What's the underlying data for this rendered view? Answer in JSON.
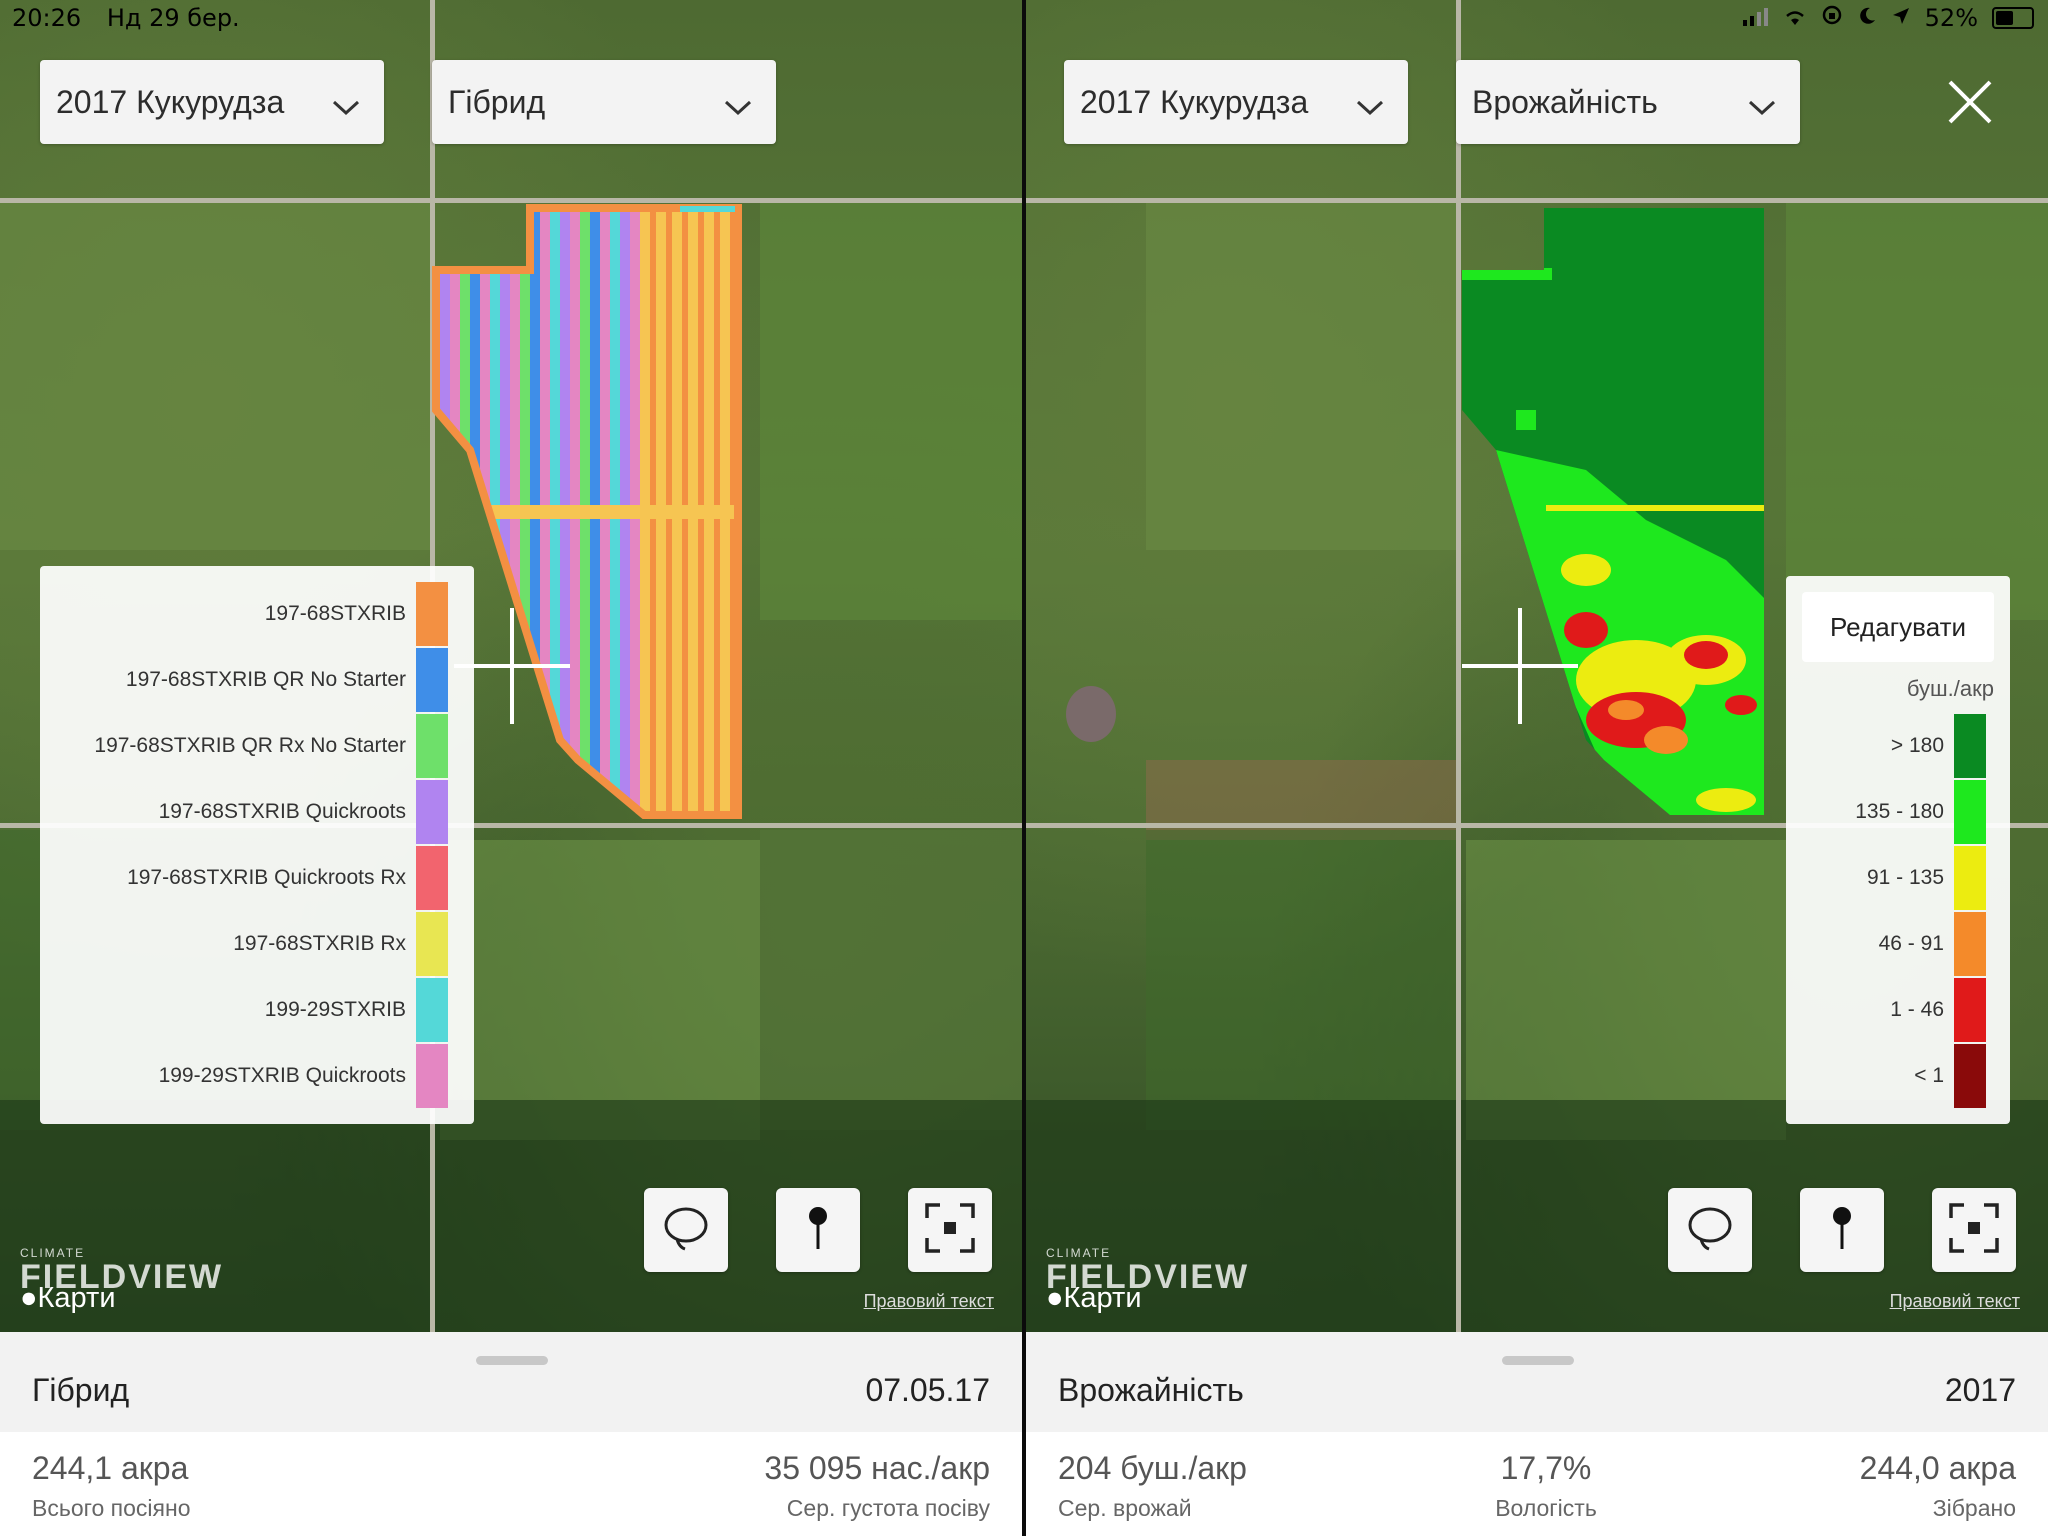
{
  "status_bar": {
    "time": "20:26",
    "date": "Нд 29 бер.",
    "battery": "52%"
  },
  "left": {
    "season_dropdown": "2017 Кукурудза",
    "layer_dropdown": "Гібрид",
    "legend": [
      {
        "label": "197-68STXRIB",
        "color": "#f39042"
      },
      {
        "label": "197-68STXRIB QR No Starter",
        "color": "#3f8ee8"
      },
      {
        "label": "197-68STXRIB QR Rx No Starter",
        "color": "#6ee06a"
      },
      {
        "label": "197-68STXRIB Quickroots",
        "color": "#b084f0"
      },
      {
        "label": "197-68STXRIB Quickroots Rx",
        "color": "#f2646e"
      },
      {
        "label": "197-68STXRIB Rx",
        "color": "#e8e652"
      },
      {
        "label": "199-29STXRIB",
        "color": "#54d8d8"
      },
      {
        "label": "199-29STXRIB Quickroots",
        "color": "#e486c2"
      }
    ],
    "sheet": {
      "title": "Гібрид",
      "date": "07.05.17",
      "stats": [
        {
          "value": "244,1 акра",
          "label": "Всього посіяно"
        },
        {
          "value": "35 095 нас./акр",
          "label": "Сер. густота посіву"
        }
      ]
    }
  },
  "right": {
    "season_dropdown": "2017 Кукурудза",
    "layer_dropdown": "Врожайність",
    "legend_edit": "Редагувати",
    "legend_unit": "буш./акр",
    "legend": [
      {
        "label": "> 180",
        "color": "#0a8a22"
      },
      {
        "label": "135 - 180",
        "color": "#1ee81e"
      },
      {
        "label": "91 - 135",
        "color": "#ecec10"
      },
      {
        "label": "46 - 91",
        "color": "#f48a2a"
      },
      {
        "label": "1 - 46",
        "color": "#e01a1a"
      },
      {
        "label": "< 1",
        "color": "#8a0a0a"
      }
    ],
    "sheet": {
      "title": "Врожайність",
      "date": "2017",
      "stats": [
        {
          "value": "204 буш./акр",
          "label": "Сер. врожай"
        },
        {
          "value": "17,7%",
          "label": "Вологість"
        },
        {
          "value": "244,0 акра",
          "label": "Зібрано"
        }
      ]
    }
  },
  "common": {
    "watermark_small": "CLIMATE",
    "watermark_big": "FIELDVIEW",
    "maps_label": "Карти",
    "legal_text": "Правовий текст"
  }
}
